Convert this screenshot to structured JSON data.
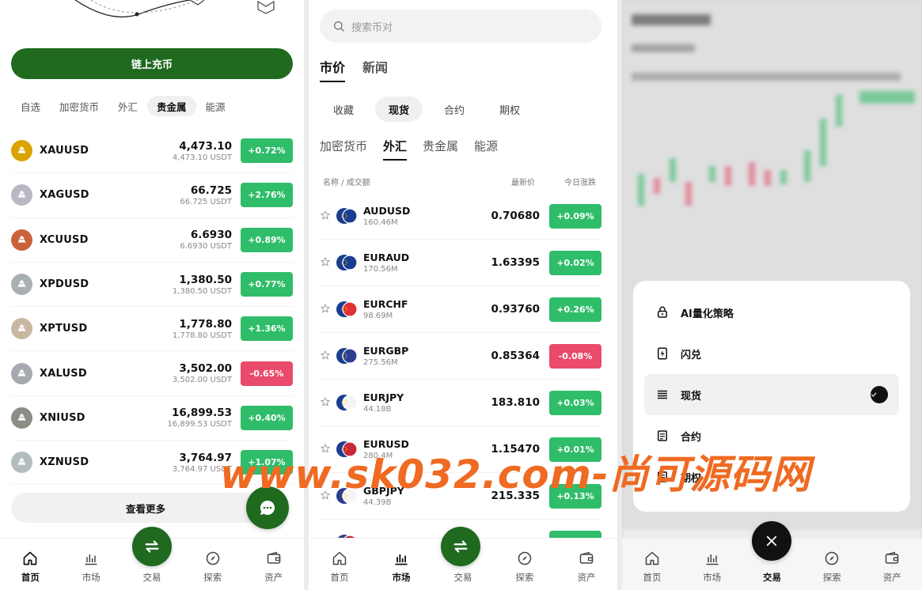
{
  "home": {
    "deposit_label": "链上充币",
    "tabs": [
      {
        "label": "自选",
        "active": false
      },
      {
        "label": "加密货币",
        "active": false
      },
      {
        "label": "外汇",
        "active": false
      },
      {
        "label": "贵金属",
        "active": true
      },
      {
        "label": "能源",
        "active": false
      }
    ],
    "rows": [
      {
        "symbol": "XAUUSD",
        "price": "4,473.10",
        "sub": "4,473.10 USDT",
        "change": "+0.72%",
        "positive": true,
        "color": "#d9a400"
      },
      {
        "symbol": "XAGUSD",
        "price": "66.725",
        "sub": "66.725 USDT",
        "change": "+2.76%",
        "positive": true,
        "color": "#b9b9c3"
      },
      {
        "symbol": "XCUUSD",
        "price": "6.6930",
        "sub": "6.6930 USDT",
        "change": "+0.89%",
        "positive": true,
        "color": "#c9623a"
      },
      {
        "symbol": "XPDUSD",
        "price": "1,380.50",
        "sub": "1,380.50 USDT",
        "change": "+0.77%",
        "positive": true,
        "color": "#a9b0b3"
      },
      {
        "symbol": "XPTUSD",
        "price": "1,778.80",
        "sub": "1,778.80 USDT",
        "change": "+1.36%",
        "positive": true,
        "color": "#c8b8a3"
      },
      {
        "symbol": "XALUSD",
        "price": "3,502.00",
        "sub": "3,502.00 USDT",
        "change": "-0.65%",
        "positive": false,
        "color": "#a6aab0"
      },
      {
        "symbol": "XNIUSD",
        "price": "16,899.53",
        "sub": "16,899.53 USDT",
        "change": "+0.40%",
        "positive": true,
        "color": "#8d8d86"
      },
      {
        "symbol": "XZNUSD",
        "price": "3,764.97",
        "sub": "3,764.97 USDT",
        "change": "+1.07%",
        "positive": true,
        "color": "#b3bcbf"
      }
    ],
    "more_label": "查看更多"
  },
  "market": {
    "search_placeholder": "搜索币对",
    "main_tabs": [
      {
        "label": "市价",
        "active": true
      },
      {
        "label": "新闻",
        "active": false
      }
    ],
    "sub_tabs": [
      {
        "label": "收藏",
        "active": false
      },
      {
        "label": "现货",
        "active": true
      },
      {
        "label": "合约",
        "active": false
      },
      {
        "label": "期权",
        "active": false
      }
    ],
    "cat_tabs": [
      {
        "label": "加密货币",
        "active": false
      },
      {
        "label": "外汇",
        "active": true
      },
      {
        "label": "贵金属",
        "active": false
      },
      {
        "label": "能源",
        "active": false
      }
    ],
    "columns": {
      "name": "名称 / 成交额",
      "price": "最新价",
      "change": "今日涨跌"
    },
    "rows": [
      {
        "symbol": "AUDUSD",
        "volume": "160.46M",
        "price": "0.70680",
        "change": "+0.09%",
        "positive": true,
        "a": "#1a3d8f",
        "b": "#1a3d8f"
      },
      {
        "symbol": "EURAUD",
        "volume": "170.56M",
        "price": "1.63395",
        "change": "+0.02%",
        "positive": true,
        "a": "#1a3d8f",
        "b": "#1a3d8f"
      },
      {
        "symbol": "EURCHF",
        "volume": "98.69M",
        "price": "0.93760",
        "change": "+0.26%",
        "positive": true,
        "a": "#1a3d8f",
        "b": "#e03030"
      },
      {
        "symbol": "EURGBP",
        "volume": "275.56M",
        "price": "0.85364",
        "change": "-0.08%",
        "positive": false,
        "a": "#1a3d8f",
        "b": "#2b3f8f"
      },
      {
        "symbol": "EURJPY",
        "volume": "44.18B",
        "price": "183.810",
        "change": "+0.03%",
        "positive": true,
        "a": "#1a3d8f",
        "b": "#f4f4f4"
      },
      {
        "symbol": "EURUSD",
        "volume": "280.4M",
        "price": "1.15470",
        "change": "+0.01%",
        "positive": true,
        "a": "#1a3d8f",
        "b": "#c8283a"
      },
      {
        "symbol": "GBPJPY",
        "volume": "44.39B",
        "price": "215.335",
        "change": "+0.13%",
        "positive": true,
        "a": "#2b3f8f",
        "b": "#f4f4f4"
      },
      {
        "symbol": "GBPUSD",
        "volume": "",
        "price": "",
        "change": "",
        "positive": true,
        "a": "#2b3f8f",
        "b": "#c8283a"
      }
    ]
  },
  "trade_menu": {
    "options": [
      {
        "label": "AI量化策略",
        "icon": "lock-icon",
        "active": false
      },
      {
        "label": "闪兑",
        "icon": "flash-icon",
        "active": false
      },
      {
        "label": "现货",
        "icon": "list-icon",
        "active": true
      },
      {
        "label": "合约",
        "icon": "document-icon",
        "active": false
      },
      {
        "label": "期权",
        "icon": "document-icon",
        "active": false
      }
    ]
  },
  "nav": {
    "home": "首页",
    "market": "市场",
    "trade": "交易",
    "explore": "探索",
    "assets": "资产"
  },
  "watermark": "www.sk032.com-尚可源码网",
  "colors": {
    "brand": "#1f6a1f",
    "up": "#2fbd6a",
    "down": "#ea4a6b"
  }
}
